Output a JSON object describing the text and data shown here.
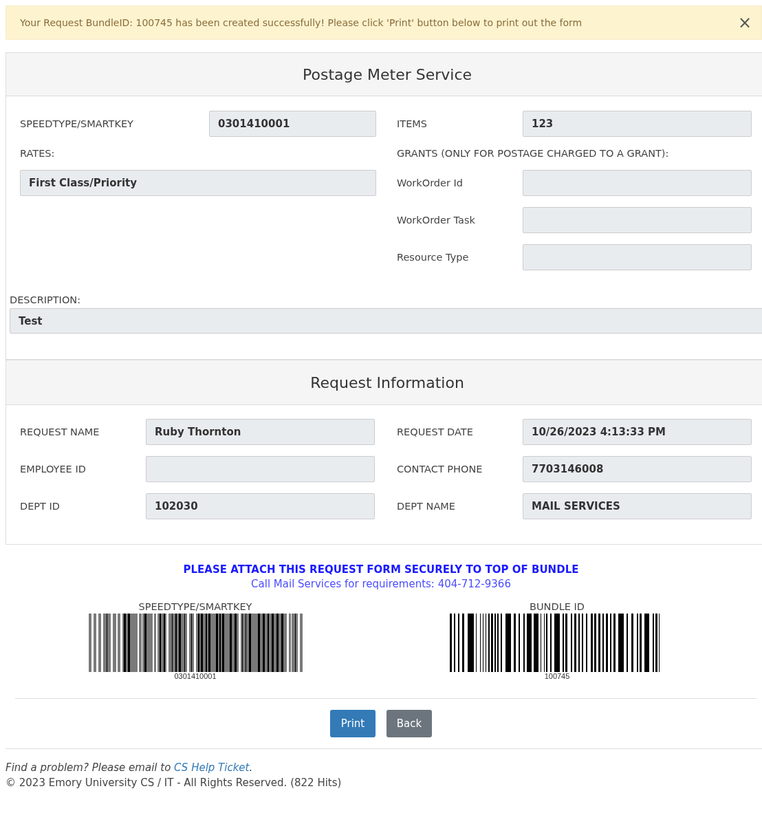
{
  "alert": {
    "message": "Your Request BundleID: 100745 has been created successfully! Please click 'Print' button below to print out the form",
    "close": "×"
  },
  "postage": {
    "title": "Postage Meter Service",
    "speedtype": {
      "label": "SPEEDTYPE/SMARTKEY",
      "value": "0301410001"
    },
    "items": {
      "label": "ITEMS",
      "value": "123"
    },
    "rates": {
      "label": "RATES:",
      "value": "First Class/Priority"
    },
    "grants_heading": "GRANTS (ONLY FOR POSTAGE CHARGED TO A GRANT):",
    "grants": [
      {
        "label": "WorkOrder Id"
      },
      {
        "label": "WorkOrder Task"
      },
      {
        "label": "Resource Type"
      }
    ],
    "description": {
      "label": "DESCRIPTION:",
      "value": "Test"
    }
  },
  "request_info": {
    "title": "Request Information",
    "fields": [
      {
        "label": "REQUEST NAME",
        "value": "Ruby Thornton"
      },
      {
        "label": "REQUEST DATE",
        "value": "10/26/2023 4:13:33 PM"
      },
      {
        "label": "EMPLOYEE ID"
      },
      {
        "label": "CONTACT PHONE",
        "value": "7703146008"
      },
      {
        "label": "DEPT ID",
        "value": "102030"
      },
      {
        "label": "DEPT NAME",
        "value": "MAIL SERVICES"
      }
    ]
  },
  "notice": "PLEASE ATTACH THIS REQUEST FORM SECURELY TO TOP OF BUNDLE",
  "contact": "Call Mail Services for requirements: 404-712-9366",
  "barcodes": [
    {
      "label": "SPEEDTYPE/SMARTKEY",
      "value": "0301410001",
      "kind": "shaded"
    },
    {
      "label": "BUNDLE ID",
      "value": "100745",
      "kind": "solid"
    }
  ],
  "buttons": [
    {
      "label": "Print",
      "kind": "primary"
    },
    {
      "label": "Back",
      "kind": "secondary"
    }
  ],
  "footer": {
    "prompt": "Find a problem? Please email to ",
    "link": "CS Help Ticket",
    "end": ".",
    "copyright": "© 2023 Emory University CS / IT - All Rights Reserved. (822 Hits)"
  }
}
